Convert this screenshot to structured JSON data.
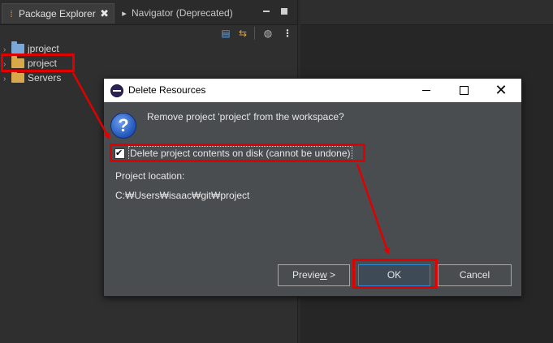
{
  "explorer": {
    "tabs": [
      {
        "label": "Package Explorer",
        "close": "✖"
      },
      {
        "label": "Navigator (Deprecated)"
      }
    ],
    "tree": [
      {
        "label": "jproject"
      },
      {
        "label": "project"
      },
      {
        "label": "Servers"
      }
    ]
  },
  "dialog": {
    "title": "Delete Resources",
    "question": "Remove project 'project' from the workspace?",
    "delete_contents_label": "Delete project contents on disk (cannot be undone)",
    "delete_contents_checked": true,
    "location_label": "Project location:",
    "location_path": "C:₩Users₩isaac₩git₩project",
    "buttons": {
      "preview": "Preview >",
      "ok": "OK",
      "cancel": "Cancel"
    }
  },
  "annotations": {
    "color": "#e00000"
  }
}
